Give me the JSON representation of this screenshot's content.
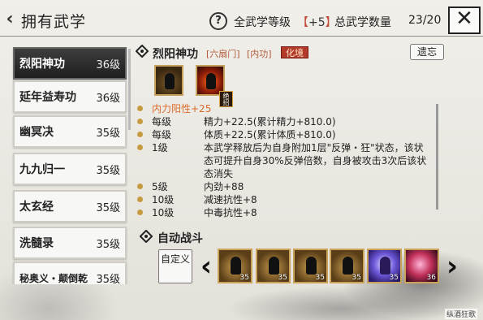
{
  "header": {
    "back_icon": "back-arrow-icon",
    "title": "拥有武学",
    "help_icon": "question-icon",
    "level_label": "全武学等级",
    "level_value": "+5",
    "total_label": "总武学数量",
    "total_value": "23/20",
    "close_icon": "close-icon"
  },
  "skill_list": {
    "items": [
      {
        "name": "烈阳神功",
        "level": "36级",
        "selected": true
      },
      {
        "name": "延年益寿功",
        "level": "36级",
        "selected": false
      },
      {
        "name": "幽冥决",
        "level": "35级",
        "selected": false
      },
      {
        "name": "九九归一",
        "level": "35级",
        "selected": false
      },
      {
        "name": "太玄经",
        "level": "35级",
        "selected": false
      },
      {
        "name": "洗髓录",
        "level": "35级",
        "selected": false
      },
      {
        "name": "秘奥义・颠倒乾",
        "level": "35级",
        "selected": false
      }
    ]
  },
  "detail": {
    "name": "烈阳神功",
    "tag_sect": "[六扇门]",
    "tag_type": "[内功]",
    "tag_realm": "化境",
    "forget_label": "遗忘",
    "special_badge": "绝招",
    "lines": [
      {
        "left": "内力阳性+25",
        "right": ""
      },
      {
        "left": "每级",
        "right": "精力+22.5(累计精力+810.0)"
      },
      {
        "left": "每级",
        "right": "体质+22.5(累计体质+810.0)"
      },
      {
        "left": "1级",
        "right": "本武学释放后为自身附加1层\"反弹・狂\"状态，该状态可提升自身30%反弹倍数，自身被攻击3次后该状态消失"
      },
      {
        "left": "5级",
        "right": "内劲+88"
      },
      {
        "left": "10级",
        "right": "减速抗性+8"
      },
      {
        "left": "10级",
        "right": "中毒抗性+8"
      }
    ]
  },
  "auto_battle": {
    "title": "自动战斗",
    "custom_label": "自定义",
    "slots": [
      {
        "level": "35",
        "style": "gold"
      },
      {
        "level": "35",
        "style": "gold"
      },
      {
        "level": "35",
        "style": "gold"
      },
      {
        "level": "35",
        "style": "gold"
      },
      {
        "level": "35",
        "style": "purple"
      },
      {
        "level": "36",
        "style": "red"
      }
    ]
  },
  "watermark": "纵酒狂歌"
}
